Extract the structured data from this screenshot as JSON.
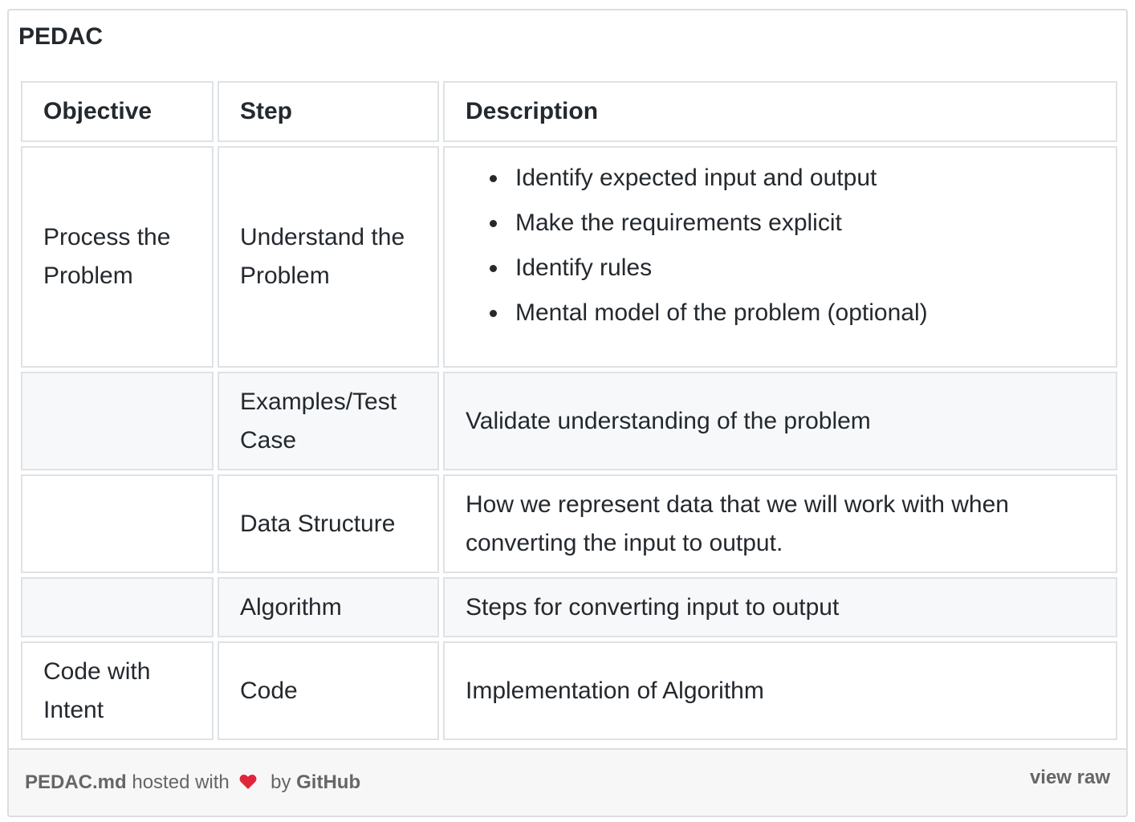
{
  "gist": {
    "title": "PEDAC"
  },
  "table": {
    "headers": [
      "Objective",
      "Step",
      "Description"
    ],
    "rows": [
      {
        "objective": "Process the Problem",
        "step": "Understand the Problem",
        "description_items": [
          "Identify expected input and output",
          "Make the requirements explicit",
          "Identify rules",
          "Mental model of the problem (optional)"
        ]
      },
      {
        "objective": "",
        "step": "Examples/Test Case",
        "description": "Validate understanding of the problem"
      },
      {
        "objective": "",
        "step": "Data Structure",
        "description": "How we represent data that we will work with when converting the input to output."
      },
      {
        "objective": "",
        "step": "Algorithm",
        "description": "Steps for converting input to output"
      },
      {
        "objective": "Code with Intent",
        "step": "Code",
        "description": "Implementation of Algorithm"
      }
    ]
  },
  "footer": {
    "file_name": "PEDAC.md",
    "hosted_with": "hosted with",
    "heart_icon": "heart-icon",
    "by": "by",
    "host": "GitHub",
    "view_raw": "view raw"
  },
  "colors": {
    "heart": "#e0263a",
    "row_shade": "#f6f8fa",
    "border": "#dfe2e5"
  }
}
